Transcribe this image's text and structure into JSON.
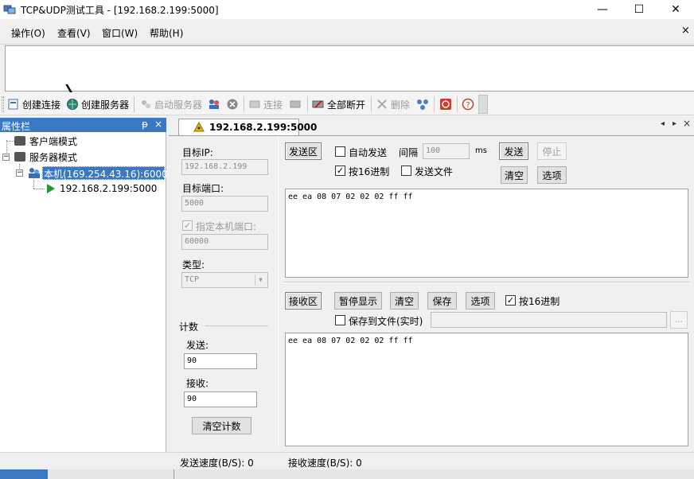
{
  "window": {
    "title": "TCP&UDP测试工具 - [192.168.2.199:5000]",
    "min_glyph": "—",
    "max_glyph": "☐",
    "close_glyph": "✕"
  },
  "menu": {
    "items": [
      "操作(O)",
      "查看(V)",
      "窗口(W)",
      "帮助(H)"
    ],
    "close_glyph": "×"
  },
  "toolbar": {
    "create_connection": "创建连接",
    "create_server": "创建服务器",
    "start_server": "启动服务器",
    "connect": "连接",
    "disconnect_all": "全部断开",
    "delete": "删除"
  },
  "properties": {
    "title": "属性栏",
    "pin_glyph": "ᵽ",
    "close_glyph": "×",
    "tree": {
      "client_mode": "客户端模式",
      "server_mode": "服务器模式",
      "local_node": "本机(169.254.43.16):60000",
      "connection_node": "192.168.2.199:5000"
    }
  },
  "tab": {
    "label": "192.168.2.199:5000",
    "prev_glyph": "◂",
    "next_glyph": "▸",
    "close_glyph": "×"
  },
  "settings": {
    "target_ip_label": "目标IP:",
    "target_ip": "192.168.2.199",
    "target_port_label": "目标端口:",
    "target_port": "5000",
    "specify_local_port_label": "指定本机端口:",
    "local_port": "60000",
    "type_label": "类型:",
    "type_value": "TCP",
    "count_label": "计数",
    "sent_label": "发送:",
    "sent_value": "90",
    "received_label": "接收:",
    "received_value": "90",
    "clear_count": "清空计数"
  },
  "send_area": {
    "area_button": "发送区",
    "auto_send_label": "自动发送",
    "interval_label": "间隔",
    "interval_value": "100",
    "interval_unit": "ms",
    "send_button": "发送",
    "stop_button": "停止",
    "hex_label": "按16进制",
    "send_file_label": "发送文件",
    "clear_button": "清空",
    "options_button": "选项",
    "content": "ee ea 08 07 02 02 02 ff ff"
  },
  "receive_area": {
    "area_button": "接收区",
    "pause_button": "暂停显示",
    "clear_button": "清空",
    "save_button": "保存",
    "options_button": "选项",
    "hex_label": "按16进制",
    "save_to_file_label": "保存到文件(实时)",
    "browse_button": "...",
    "content": "ee ea 08 07 02 02 02 ff ff"
  },
  "status": {
    "send_speed": "发送速度(B/S): 0",
    "receive_speed": "接收速度(B/S): 0"
  },
  "colors": {
    "selection": "#3b78c4",
    "panel_header": "#3b78c4",
    "play_green": "#1a9e2a"
  }
}
